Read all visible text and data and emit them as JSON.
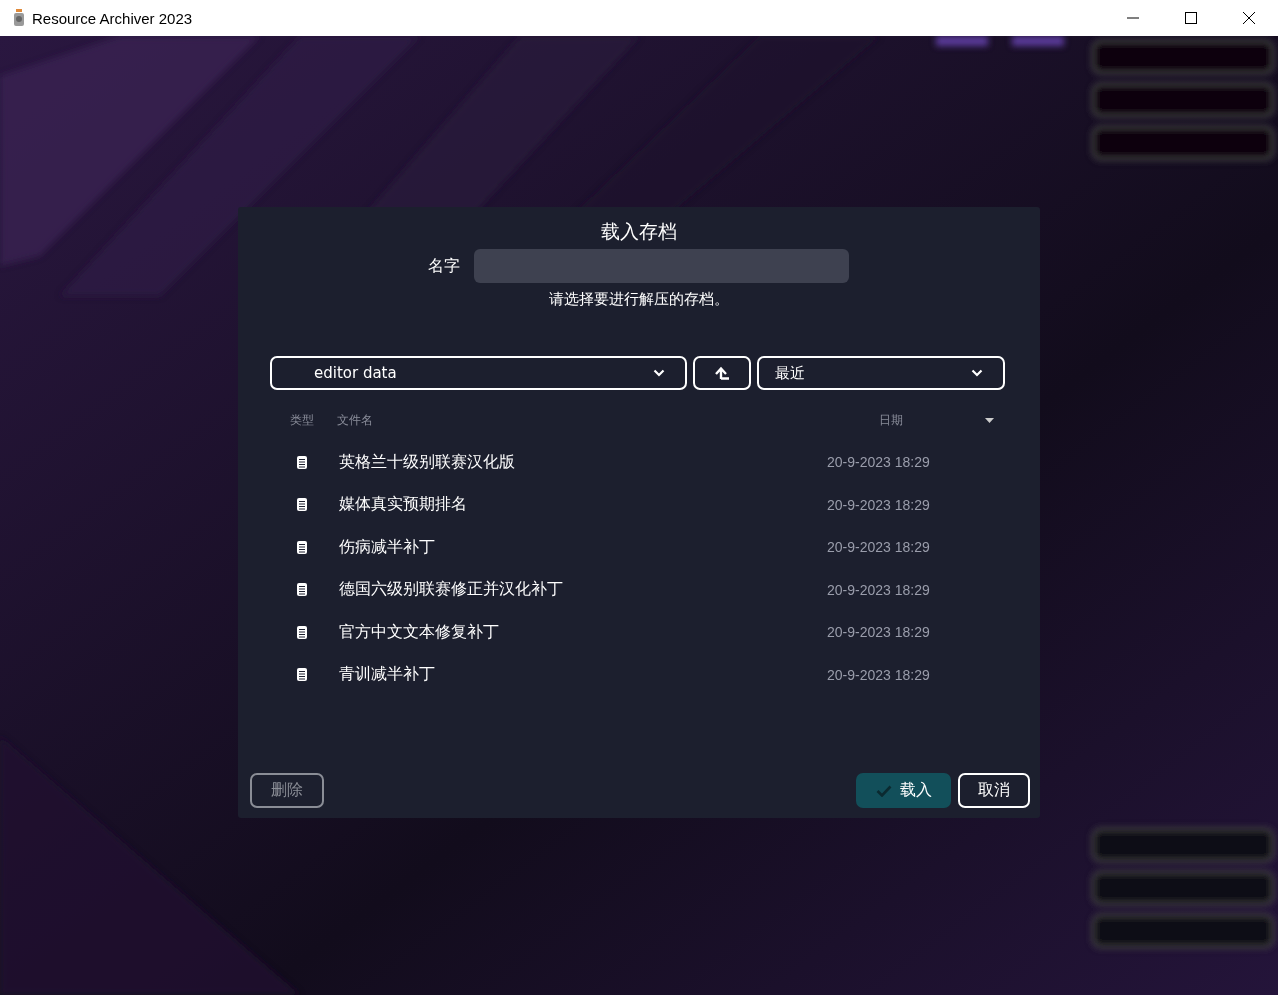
{
  "window": {
    "title": "Resource Archiver 2023"
  },
  "dialog": {
    "title": "载入存档",
    "name_label": "名字",
    "hint": "请选择要进行解压的存档。",
    "path_select": "editor data",
    "sort_select": "最近",
    "columns": [
      {
        "kind": "type",
        "label": "类型"
      },
      {
        "kind": "name",
        "label": "文件名"
      },
      {
        "kind": "date",
        "label": "日期"
      }
    ],
    "files": [
      {
        "name": "英格兰十级别联赛汉化版",
        "date": "20-9-2023 18:29"
      },
      {
        "name": "媒体真实预期排名",
        "date": "20-9-2023 18:29"
      },
      {
        "name": "伤病减半补丁",
        "date": "20-9-2023 18:29"
      },
      {
        "name": "德国六级别联赛修正并汉化补丁",
        "date": "20-9-2023 18:29"
      },
      {
        "name": "官方中文文本修复补丁",
        "date": "20-9-2023 18:29"
      },
      {
        "name": "青训减半补丁",
        "date": "20-9-2023 18:29"
      }
    ],
    "buttons": [
      {
        "kind": "delete",
        "label": "删除",
        "disabled": true
      },
      {
        "kind": "load",
        "label": "载入",
        "disabled": false
      },
      {
        "kind": "cancel",
        "label": "取消",
        "disabled": false
      }
    ]
  }
}
